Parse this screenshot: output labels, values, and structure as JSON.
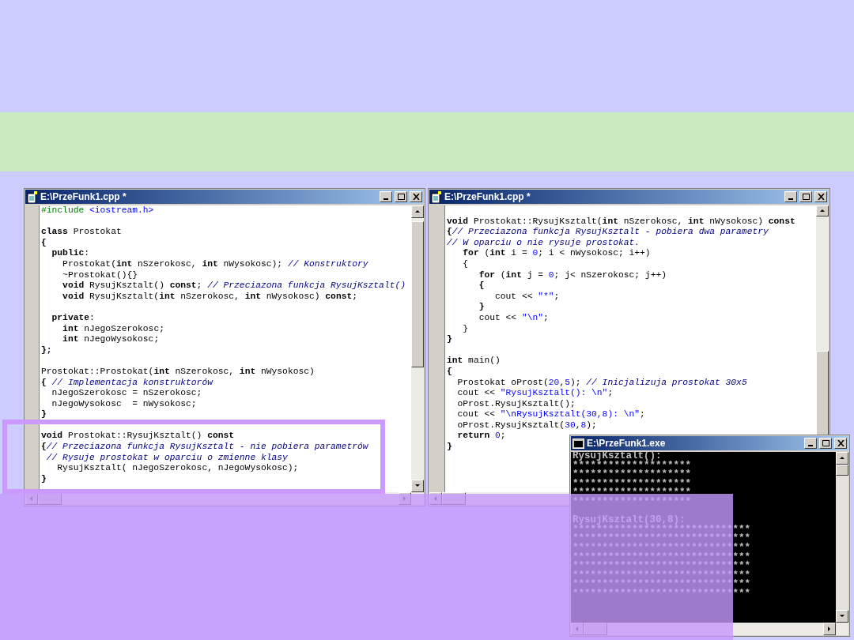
{
  "windows": [
    {
      "kind": "editor",
      "title": "E:\\PrzeFunk1.cpp *",
      "lines": [
        {
          "tokens": [
            {
              "kind": "pre",
              "text": "#include "
            },
            {
              "kind": "str",
              "text": "<iostream.h>"
            }
          ]
        },
        {
          "kind": "blank"
        },
        {
          "tokens": [
            {
              "kind": "kw",
              "text": "class"
            },
            {
              "kind": "plain",
              "text": " Prostokat"
            }
          ]
        },
        {
          "tokens": [
            {
              "kind": "kw",
              "text": "{"
            }
          ]
        },
        {
          "tokens": [
            {
              "kind": "kw",
              "text": "  public"
            },
            {
              "kind": "plain",
              "text": ":"
            }
          ]
        },
        {
          "tokens": [
            {
              "kind": "plain",
              "text": "    Prostokat("
            },
            {
              "kind": "kw",
              "text": "int"
            },
            {
              "kind": "plain",
              "text": " nSzerokosc, "
            },
            {
              "kind": "kw",
              "text": "int"
            },
            {
              "kind": "plain",
              "text": " nWysokosc); "
            },
            {
              "kind": "comment",
              "text": "// Konstruktory"
            }
          ]
        },
        {
          "tokens": [
            {
              "kind": "plain",
              "text": "    ~Prostokat(){}"
            }
          ]
        },
        {
          "tokens": [
            {
              "kind": "kw",
              "text": "    void"
            },
            {
              "kind": "plain",
              "text": " RysujKsztalt() "
            },
            {
              "kind": "kw",
              "text": "const"
            },
            {
              "kind": "plain",
              "text": "; "
            },
            {
              "kind": "comment",
              "text": "// Przeciazona funkcja RysujKsztalt()"
            }
          ]
        },
        {
          "tokens": [
            {
              "kind": "kw",
              "text": "    void"
            },
            {
              "kind": "plain",
              "text": " RysujKsztalt("
            },
            {
              "kind": "kw",
              "text": "int"
            },
            {
              "kind": "plain",
              "text": " nSzerokosc, "
            },
            {
              "kind": "kw",
              "text": "int"
            },
            {
              "kind": "plain",
              "text": " nWysokosc) "
            },
            {
              "kind": "kw",
              "text": "const"
            },
            {
              "kind": "plain",
              "text": ";"
            }
          ]
        },
        {
          "kind": "blank"
        },
        {
          "tokens": [
            {
              "kind": "kw",
              "text": "  private"
            },
            {
              "kind": "plain",
              "text": ":"
            }
          ]
        },
        {
          "tokens": [
            {
              "kind": "kw",
              "text": "    int"
            },
            {
              "kind": "plain",
              "text": " nJegoSzerokosc;"
            }
          ]
        },
        {
          "tokens": [
            {
              "kind": "kw",
              "text": "    int"
            },
            {
              "kind": "plain",
              "text": " nJegoWysokosc;"
            }
          ]
        },
        {
          "tokens": [
            {
              "kind": "kw",
              "text": "};"
            }
          ]
        },
        {
          "kind": "blank"
        },
        {
          "tokens": [
            {
              "kind": "plain",
              "text": "Prostokat::Prostokat("
            },
            {
              "kind": "kw",
              "text": "int"
            },
            {
              "kind": "plain",
              "text": " nSzerokosc, "
            },
            {
              "kind": "kw",
              "text": "int"
            },
            {
              "kind": "plain",
              "text": " nWysokosc)"
            }
          ]
        },
        {
          "tokens": [
            {
              "kind": "kw",
              "text": "{"
            },
            {
              "kind": "comment",
              "text": " // Implementacja konstruktorów"
            }
          ]
        },
        {
          "tokens": [
            {
              "kind": "plain",
              "text": "  nJegoSzerokosc = nSzerokosc;"
            }
          ]
        },
        {
          "tokens": [
            {
              "kind": "plain",
              "text": "  nJegoWysokosc  = nWysokosc;"
            }
          ]
        },
        {
          "tokens": [
            {
              "kind": "kw",
              "text": "}"
            }
          ]
        },
        {
          "kind": "blank"
        },
        {
          "tokens": [
            {
              "kind": "kw",
              "text": "void"
            },
            {
              "kind": "plain",
              "text": " Prostokat::RysujKsztalt() "
            },
            {
              "kind": "kw",
              "text": "const"
            }
          ]
        },
        {
          "tokens": [
            {
              "kind": "kw",
              "text": "{"
            },
            {
              "kind": "comment",
              "text": "// Przeciazona funkcja RysujKsztalt - nie pobiera parametrów"
            }
          ]
        },
        {
          "tokens": [
            {
              "kind": "comment",
              "text": " // Rysuje prostokat w oparciu o zmienne klasy"
            }
          ]
        },
        {
          "tokens": [
            {
              "kind": "plain",
              "text": "   RysujKsztalt( nJegoSzerokosc, nJegoWysokosc);"
            }
          ]
        },
        {
          "tokens": [
            {
              "kind": "kw",
              "text": "}"
            }
          ]
        }
      ]
    },
    {
      "kind": "editor",
      "title": "E:\\PrzeFunk1.cpp *",
      "lines": [
        {
          "kind": "blank"
        },
        {
          "tokens": [
            {
              "kind": "kw",
              "text": "void"
            },
            {
              "kind": "plain",
              "text": " Prostokat::RysujKsztalt("
            },
            {
              "kind": "kw",
              "text": "int"
            },
            {
              "kind": "plain",
              "text": " nSzerokosc, "
            },
            {
              "kind": "kw",
              "text": "int"
            },
            {
              "kind": "plain",
              "text": " nWysokosc) "
            },
            {
              "kind": "kw",
              "text": "const"
            }
          ]
        },
        {
          "tokens": [
            {
              "kind": "kw",
              "text": "{"
            },
            {
              "kind": "comment",
              "text": "// Przeciazona funkcja RysujKsztalt - pobiera dwa parametry"
            }
          ]
        },
        {
          "tokens": [
            {
              "kind": "comment",
              "text": "// W oparciu o nie rysuje prostokat."
            }
          ]
        },
        {
          "tokens": [
            {
              "kind": "kw",
              "text": "   for"
            },
            {
              "kind": "plain",
              "text": " ("
            },
            {
              "kind": "kw",
              "text": "int"
            },
            {
              "kind": "plain",
              "text": " i = "
            },
            {
              "kind": "str",
              "text": "0"
            },
            {
              "kind": "plain",
              "text": "; i < nWysokosc; i++)"
            }
          ]
        },
        {
          "tokens": [
            {
              "kind": "plain",
              "text": "   {"
            }
          ]
        },
        {
          "tokens": [
            {
              "kind": "kw",
              "text": "      for"
            },
            {
              "kind": "plain",
              "text": " ("
            },
            {
              "kind": "kw",
              "text": "int"
            },
            {
              "kind": "plain",
              "text": " j = "
            },
            {
              "kind": "str",
              "text": "0"
            },
            {
              "kind": "plain",
              "text": "; j< nSzerokosc; j++)"
            }
          ]
        },
        {
          "tokens": [
            {
              "kind": "kw",
              "text": "      {"
            }
          ]
        },
        {
          "tokens": [
            {
              "kind": "plain",
              "text": "         cout << "
            },
            {
              "kind": "str",
              "text": "\"*\""
            },
            {
              "kind": "plain",
              "text": ";"
            }
          ]
        },
        {
          "tokens": [
            {
              "kind": "kw",
              "text": "      }"
            }
          ]
        },
        {
          "tokens": [
            {
              "kind": "plain",
              "text": "      cout << "
            },
            {
              "kind": "str",
              "text": "\"\\n\""
            },
            {
              "kind": "plain",
              "text": ";"
            }
          ]
        },
        {
          "tokens": [
            {
              "kind": "plain",
              "text": "   }"
            }
          ]
        },
        {
          "tokens": [
            {
              "kind": "kw",
              "text": "}"
            }
          ]
        },
        {
          "kind": "blank"
        },
        {
          "tokens": [
            {
              "kind": "kw",
              "text": "int"
            },
            {
              "kind": "plain",
              "text": " main()"
            }
          ]
        },
        {
          "tokens": [
            {
              "kind": "kw",
              "text": "{"
            }
          ]
        },
        {
          "tokens": [
            {
              "kind": "plain",
              "text": "  Prostokat oProst("
            },
            {
              "kind": "str",
              "text": "20"
            },
            {
              "kind": "plain",
              "text": ","
            },
            {
              "kind": "str",
              "text": "5"
            },
            {
              "kind": "plain",
              "text": "); "
            },
            {
              "kind": "comment",
              "text": "// Inicjalizuja prostokat 30x5"
            }
          ]
        },
        {
          "tokens": [
            {
              "kind": "plain",
              "text": "  cout << "
            },
            {
              "kind": "str",
              "text": "\"RysujKsztalt(): \\n\""
            },
            {
              "kind": "plain",
              "text": ";"
            }
          ]
        },
        {
          "tokens": [
            {
              "kind": "plain",
              "text": "  oProst.RysujKsztalt();"
            }
          ]
        },
        {
          "tokens": [
            {
              "kind": "plain",
              "text": "  cout << "
            },
            {
              "kind": "str",
              "text": "\"\\nRysujKsztalt(30,8): \\n\""
            },
            {
              "kind": "plain",
              "text": ";"
            }
          ]
        },
        {
          "tokens": [
            {
              "kind": "plain",
              "text": "  oProst.RysujKsztalt("
            },
            {
              "kind": "str",
              "text": "30"
            },
            {
              "kind": "plain",
              "text": ","
            },
            {
              "kind": "str",
              "text": "8"
            },
            {
              "kind": "plain",
              "text": ");"
            }
          ]
        },
        {
          "tokens": [
            {
              "kind": "kw",
              "text": "  return "
            },
            {
              "kind": "str",
              "text": "0"
            },
            {
              "kind": "plain",
              "text": ";"
            }
          ]
        },
        {
          "tokens": [
            {
              "kind": "kw",
              "text": "}"
            }
          ]
        }
      ]
    },
    {
      "kind": "console",
      "title": "E:\\PrzeFunk1.exe",
      "lines": [
        {
          "text": "RysujKsztalt():"
        },
        {
          "text": "********************"
        },
        {
          "text": "********************"
        },
        {
          "text": "********************"
        },
        {
          "text": "********************"
        },
        {
          "text": "********************"
        },
        {
          "kind": "blank"
        },
        {
          "text": "RysujKsztalt(30,8):"
        },
        {
          "text": "******************************"
        },
        {
          "text": "******************************"
        },
        {
          "text": "******************************"
        },
        {
          "text": "******************************"
        },
        {
          "text": "******************************"
        },
        {
          "text": "******************************"
        },
        {
          "text": "******************************"
        },
        {
          "text": "******************************"
        }
      ]
    }
  ]
}
